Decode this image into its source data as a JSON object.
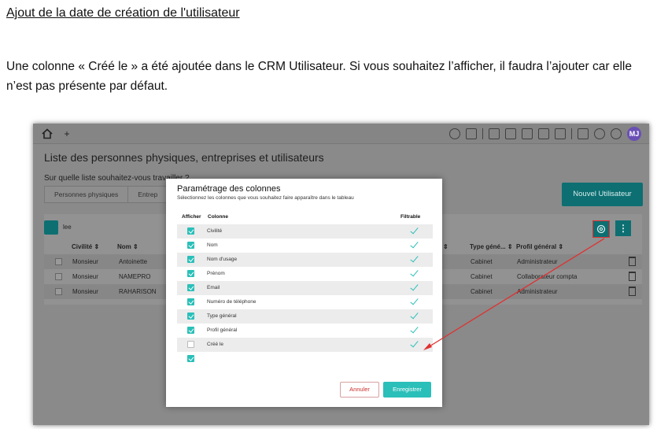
{
  "doc": {
    "title": "Ajout de la date de création de l'utilisateur",
    "paragraph": "Une colonne « Créé le » a été ajoutée dans le CRM Utilisateur. Si vous souhaitez l’afficher, il faudra l’ajouter car elle n’est pas présente par défaut."
  },
  "app": {
    "tab_plus": "+",
    "avatar_initials": "MJ",
    "page_title": "Liste des personnes physiques, entreprises et utilisateurs",
    "question": "Sur quelle liste souhaitez-vous travailler ?",
    "segments": [
      "Personnes physiques",
      "Entrep"
    ],
    "new_user_button": "Nouvel Utilisateur",
    "search_value": "lee",
    "more_button": "⋮",
    "headers": {
      "civilite": "Civilité ⇕",
      "nom": "Nom ⇕",
      "hidden_sort": "⇕",
      "type_general": "Type géné... ⇕",
      "profil_general": "Profil général ⇕"
    },
    "rows": [
      {
        "civilite": "Monsieur",
        "nom": "Antoinette",
        "type": "Cabinet",
        "profil": "Administrateur"
      },
      {
        "civilite": "Monsieur",
        "nom": "NAMEPRO",
        "type": "Cabinet",
        "profil": "Collaborateur compta"
      },
      {
        "civilite": "Monsieur",
        "nom": "RAHARISON",
        "type": "Cabinet",
        "profil": "Administrateur"
      }
    ]
  },
  "modal": {
    "title": "Paramétrage des colonnes",
    "subtitle": "Sélectionnez les colonnes que vous souhaitez faire apparaître dans le tableau",
    "col_show": "Afficher",
    "col_column": "Colonne",
    "col_filterable": "Filtrable",
    "columns": [
      {
        "label": "Civilité",
        "shown": true,
        "filterable": true
      },
      {
        "label": "Nom",
        "shown": true,
        "filterable": true
      },
      {
        "label": "Nom d'usage",
        "shown": true,
        "filterable": true
      },
      {
        "label": "Prénom",
        "shown": true,
        "filterable": true
      },
      {
        "label": "Email",
        "shown": true,
        "filterable": true
      },
      {
        "label": "Numéro de téléphone",
        "shown": true,
        "filterable": true
      },
      {
        "label": "Type général",
        "shown": true,
        "filterable": true
      },
      {
        "label": "Profil général",
        "shown": true,
        "filterable": true
      },
      {
        "label": "Créé le",
        "shown": false,
        "filterable": true
      },
      {
        "label": "",
        "shown": true,
        "filterable": false
      }
    ],
    "cancel": "Annuler",
    "save": "Enregistrer"
  },
  "colors": {
    "teal": "#2bbfb9",
    "dark_teal": "#0d6f72",
    "annotation_red": "#e03030",
    "avatar": "#6a4fb5"
  }
}
